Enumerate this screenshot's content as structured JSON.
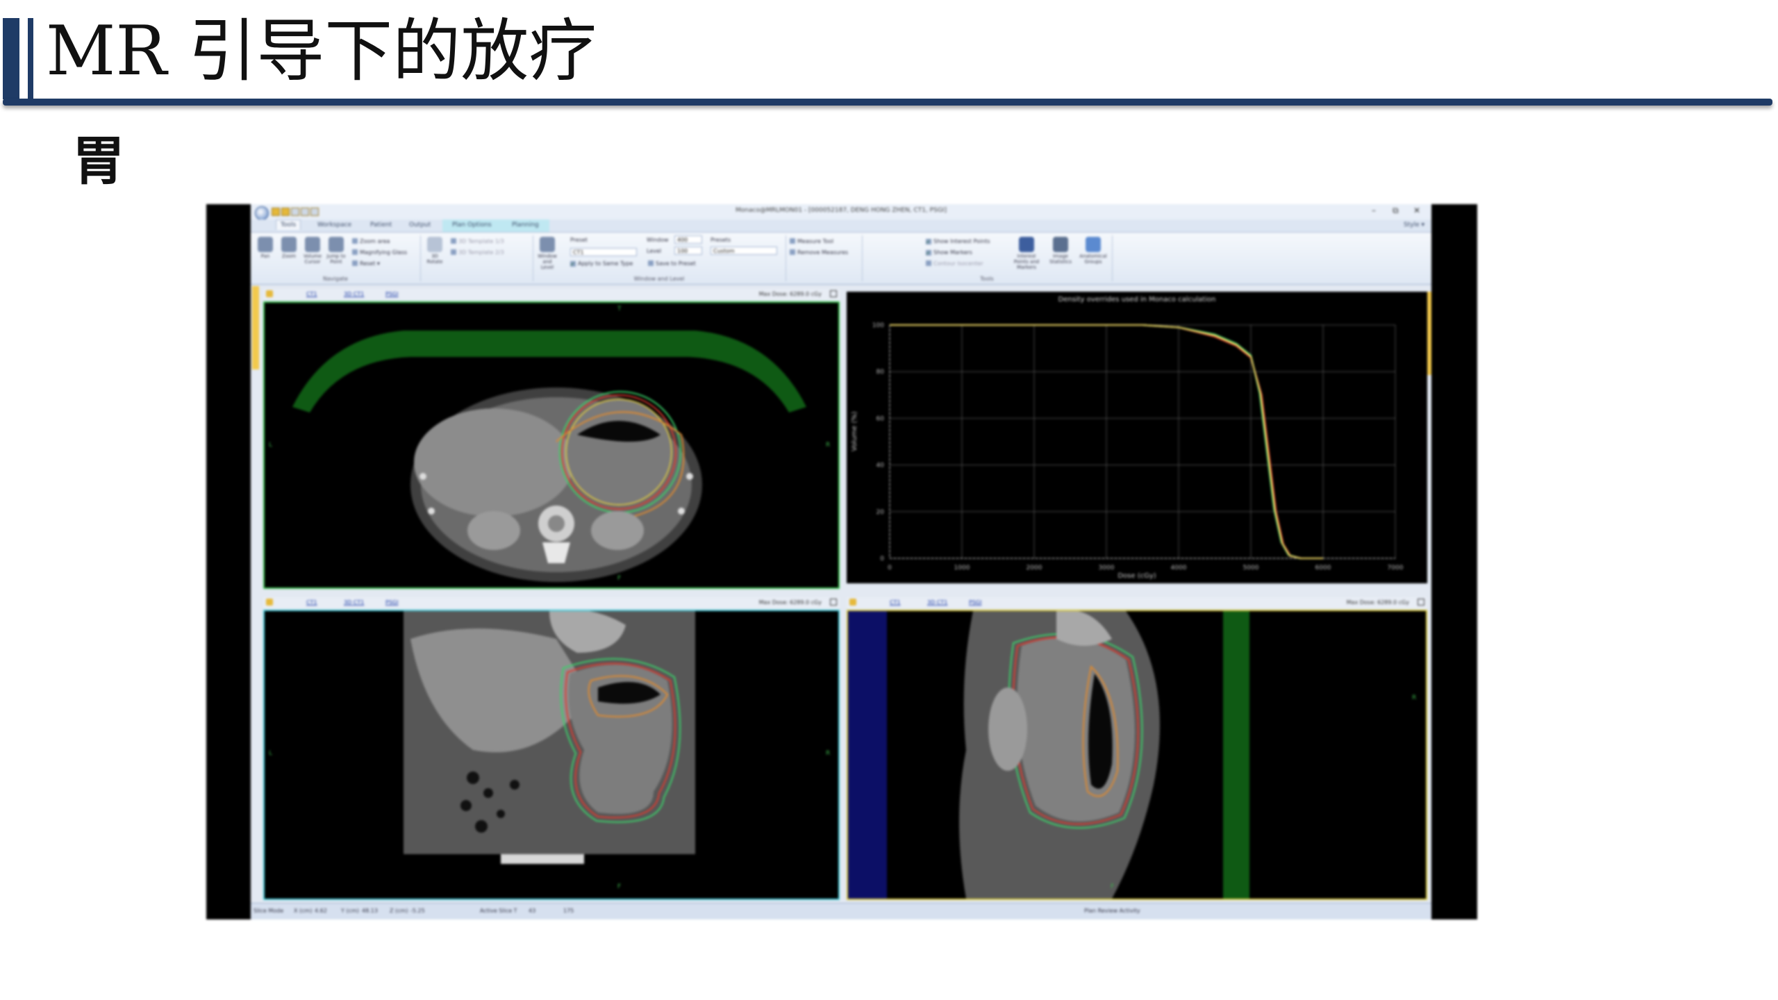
{
  "slide": {
    "title": "MR 引导下的放疗",
    "subtitle": "胃"
  },
  "window": {
    "title": "Monaco@MRLMON01 - [000052187, DENG HONG ZHEN, CT1, PSGI]",
    "minimize": "–",
    "maximize": "⧉",
    "close": "✕"
  },
  "tabs": [
    "Tools",
    "Workspace",
    "Patient",
    "Output",
    "Plan Options",
    "Planning"
  ],
  "tab_right": "Style ▾",
  "ribbon": {
    "navigate": {
      "label": "Navigate",
      "buttons": [
        "Pan",
        "Zoom",
        "Volume Cursor",
        "Jump to Point"
      ],
      "items": [
        "Zoom area",
        "Magnifying Glass",
        "Reset ▾"
      ]
    },
    "threed": {
      "label": "3D",
      "items": [
        "3D Template 1/3",
        "3D Template 2/3"
      ],
      "button": "3D Rotate"
    },
    "window_level": {
      "label": "Window and Level",
      "button": "Window and Level",
      "preset_label": "Preset",
      "preset": "CT1",
      "window_label": "Window",
      "window_value": "400",
      "level_label": "Level",
      "level_value": "100",
      "presets_label": "Presets",
      "presets_value": "Custom",
      "apply": "Apply to Same Type",
      "save": "Save to Preset"
    },
    "measure": {
      "items": [
        "Measure Tool",
        "Remove Measures"
      ]
    },
    "tools": {
      "label": "Tools",
      "items": [
        "Show Interest Points",
        "Show Markers",
        "Contour Isocenter"
      ],
      "buttons": [
        "Interest Points and Markers",
        "Image Statistics",
        "Anatomical Groups"
      ]
    }
  },
  "viewports": {
    "axial": {
      "tabs": [
        "CT1",
        "3D CT1",
        "PSGI"
      ],
      "dose": "Max Dose: 6289.0 cGy"
    },
    "coronal": {
      "tabs": [
        "CT1",
        "3D CT1",
        "PSGI"
      ],
      "dose": "Max Dose: 6289.0 cGy"
    },
    "sagittal": {
      "tabs": [
        "CT1",
        "3D CT1",
        "PSGI"
      ],
      "dose": "Max Dose: 6289.0 cGy"
    },
    "orient_marks": [
      "T",
      "L",
      "R",
      "F"
    ]
  },
  "chart_data": {
    "type": "line",
    "title": "Density overrides used in Monaco calculation",
    "xlabel": "Dose (cGy)",
    "ylabel": "Volume (%)",
    "xlim": [
      0,
      7000
    ],
    "ylim": [
      0,
      100
    ],
    "xticks": [
      0,
      1000,
      2000,
      3000,
      4000,
      5000,
      6000,
      7000
    ],
    "yticks": [
      0,
      20,
      40,
      60,
      80,
      100
    ],
    "grid": true,
    "series": [
      {
        "color": "#e03a2f",
        "x": [
          0,
          3500,
          4000,
          4500,
          4800,
          5000,
          5150,
          5250,
          5350,
          5450,
          5550,
          5700,
          6000
        ],
        "y": [
          100,
          100,
          99,
          95,
          91,
          86,
          70,
          45,
          20,
          6,
          1,
          0,
          0
        ]
      },
      {
        "color": "#3bd16a",
        "x": [
          0,
          3500,
          4000,
          4500,
          4800,
          5000,
          5120,
          5220,
          5320,
          5420,
          5520,
          5680,
          6000
        ],
        "y": [
          100,
          100,
          99,
          96,
          92,
          87,
          71,
          46,
          21,
          7,
          1.5,
          0,
          0
        ]
      },
      {
        "color": "#ffe66b",
        "x": [
          0,
          3500,
          4000,
          4500,
          4800,
          5000,
          5135,
          5235,
          5335,
          5435,
          5535,
          5690,
          6000
        ],
        "y": [
          100,
          100,
          99,
          95.5,
          91.5,
          86.5,
          70.5,
          45.5,
          20.5,
          6.5,
          1.2,
          0,
          0
        ]
      }
    ]
  },
  "statusbar": {
    "slice_mode": "Slice Mode",
    "x_label": "X (cm)",
    "x_value": "4.62",
    "y_label": "Y (cm)",
    "y_value": "48.13",
    "z_label": "Z (cm)",
    "z_value": "-5.25",
    "active_label": "Active Slice T",
    "active_value": "43",
    "zoom": "175",
    "message": "Plan Review Activity"
  }
}
